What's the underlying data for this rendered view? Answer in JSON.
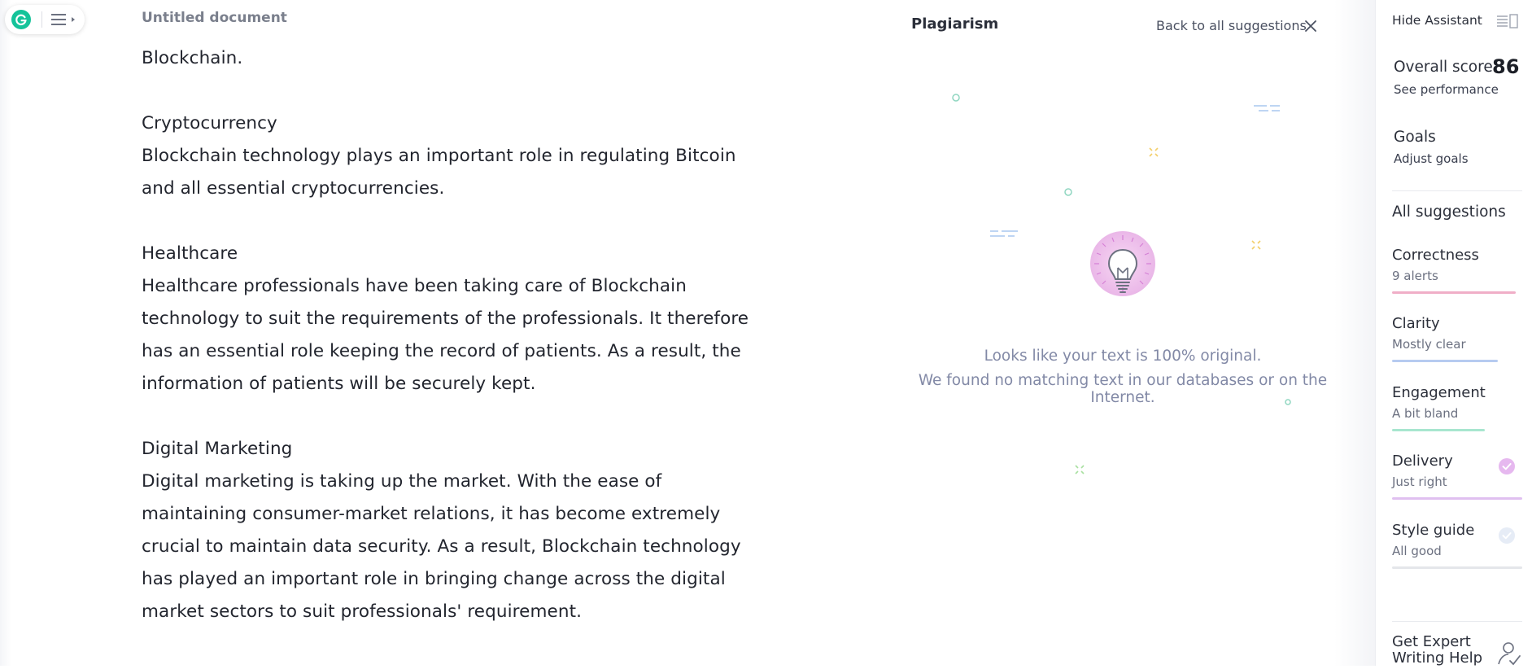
{
  "app": {
    "doc_title": "Untitled document"
  },
  "document": {
    "paragraphs": [
      "Blockchain.",
      "Cryptocurrency\nBlockchain technology plays an important role in regulating Bitcoin and all essential cryptocurrencies.",
      "Healthcare\nHealthcare professionals have been taking care of Blockchain technology to suit the requirements of the professionals. It therefore has an essential role keeping the record of patients. As a result, the information of patients will be securely kept.",
      "Digital Marketing\nDigital marketing is taking up the market. With the ease of maintaining consumer-market relations, it has become extremely crucial to maintain data security. As a result, Blockchain technology has played an important role in bringing change across the digital market sectors to suit professionals' requirement."
    ]
  },
  "plagiarism": {
    "title": "Plagiarism",
    "back_label": "Back to all suggestions",
    "message_line1": "Looks like your text is 100% original.",
    "message_line2": "We found no matching text in our databases or on the Internet.",
    "icon": "lightbulb-icon"
  },
  "sidebar": {
    "hide_label": "Hide Assistant",
    "overall_label": "Overall score",
    "overall_score": "86",
    "see_performance": "See performance",
    "goals_label": "Goals",
    "adjust_goals": "Adjust goals",
    "all_suggestions": "All suggestions",
    "categories": [
      {
        "name": "Correctness",
        "status": "9 alerts",
        "color": "#f0aec7"
      },
      {
        "name": "Clarity",
        "status": "Mostly clear",
        "color": "#b6cbf0"
      },
      {
        "name": "Engagement",
        "status": "A bit bland",
        "color": "#a8e6cf"
      },
      {
        "name": "Delivery",
        "status": "Just right",
        "color": "#e0c0f0"
      },
      {
        "name": "Style guide",
        "status": "All good",
        "color": "#e4e6ea"
      }
    ],
    "expert_label": "Get Expert Writing Help"
  },
  "colors": {
    "brand": "#15c39a",
    "accent_bulb": "#d580d6"
  }
}
